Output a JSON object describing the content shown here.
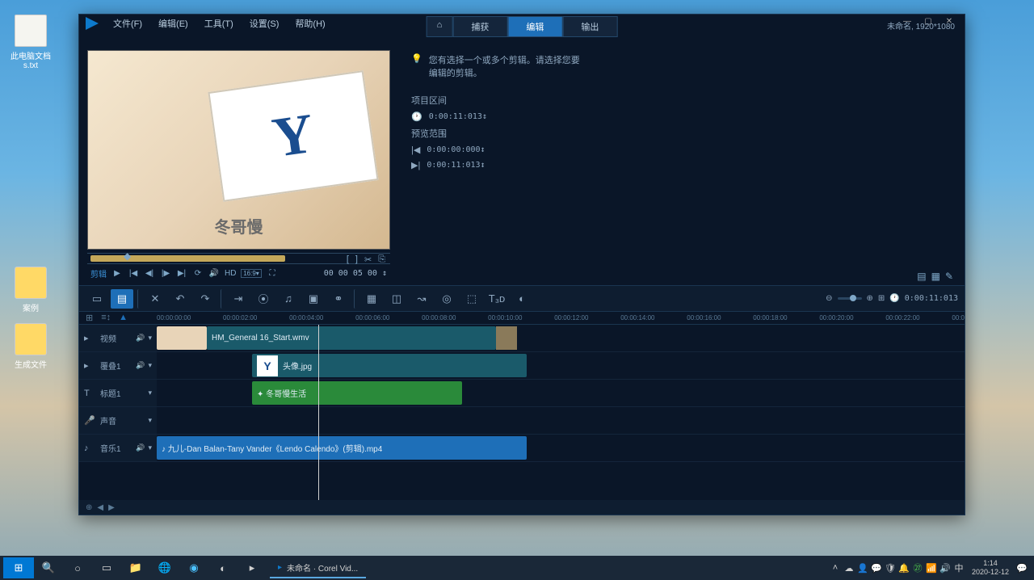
{
  "desktop": {
    "icons": [
      {
        "label": "此电脑文档\ns.txt"
      },
      {
        "label": "案例"
      },
      {
        "label": "生成文件"
      }
    ]
  },
  "app": {
    "menus": [
      "文件(F)",
      "编辑(E)",
      "工具(T)",
      "设置(S)",
      "帮助(H)"
    ],
    "modes": {
      "home": "⌂",
      "capture": "捕获",
      "edit": "编辑",
      "output": "输出"
    },
    "project_info": "未命名, 1920*1080",
    "preview_text": "冬哥慢",
    "preview_y": "Y",
    "scrub_icons": [
      "[",
      "]",
      "✂",
      "⎘"
    ],
    "transport": {
      "mode": "剪辑",
      "tc": "00 00 05 00 ↕"
    },
    "info": {
      "hint": "您有选择一个或多个剪辑。请选择您要\n编辑的剪辑。",
      "duration_label": "项目区间",
      "duration": "0:00:11:013↕",
      "range_label": "预览范围",
      "range_start": "0:00:00:000↕",
      "range_end": "0:00:11:013↕"
    },
    "toolbar_tc": "0:00:11:013",
    "ruler": [
      "00:00:00:00",
      "00:00:02:00",
      "00:00:04:00",
      "00:00:06:00",
      "00:00:08:00",
      "00:00:10:00",
      "00:00:12:00",
      "00:00:14:00",
      "00:00:16:00",
      "00:00:18:00",
      "00:00:20:00",
      "00:00:22:00",
      "00:0"
    ],
    "tracks": {
      "video": "视频",
      "overlay": "覆叠1",
      "title": "标题1",
      "voice": "声音",
      "music": "音乐1"
    },
    "clips": {
      "video1": "HM_General 16_Start.wmv",
      "overlay": "头像.jpg",
      "title": "✦ 冬哥慢生活",
      "audio": "♪ 九儿-Dan Balan-Tany Vander《Lendo Calendo》(剪辑).mp4"
    }
  },
  "taskbar": {
    "app": "未命名 · Corel Vid...",
    "time": "1:14",
    "date": "2020-12-12"
  }
}
